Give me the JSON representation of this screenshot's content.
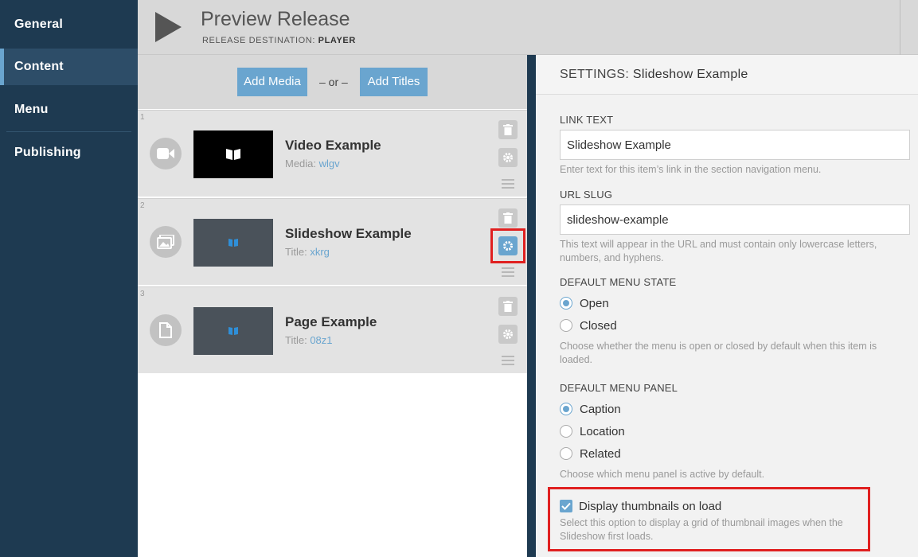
{
  "sidebar": {
    "items": [
      {
        "label": "General"
      },
      {
        "label": "Content"
      },
      {
        "label": "Menu"
      },
      {
        "label": "Publishing"
      }
    ]
  },
  "header": {
    "title": "Preview Release",
    "destination_label": "RELEASE DESTINATION:",
    "destination_value": "PLAYER"
  },
  "toolbar": {
    "add_media": "Add Media",
    "or": "– or –",
    "add_titles": "Add Titles"
  },
  "items": [
    {
      "number": "1",
      "title": "Video Example",
      "meta_label": "Media:",
      "meta_value": "wlgv",
      "type_icon": "video-camera-icon"
    },
    {
      "number": "2",
      "title": "Slideshow Example",
      "meta_label": "Title:",
      "meta_value": "xkrg",
      "type_icon": "images-icon"
    },
    {
      "number": "3",
      "title": "Page Example",
      "meta_label": "Title:",
      "meta_value": "08z1",
      "type_icon": "page-icon"
    }
  ],
  "settings": {
    "heading_prefix": "SETTINGS:",
    "heading_name": "Slideshow Example",
    "link_text_label": "LINK TEXT",
    "link_text_value": "Slideshow Example",
    "link_text_hint": "Enter text for this item’s link in the section navigation menu.",
    "url_slug_label": "URL SLUG",
    "url_slug_value": "slideshow-example",
    "url_slug_hint": "This text will appear in the URL and must contain only lowercase letters, numbers, and hyphens.",
    "menu_state_label": "DEFAULT MENU STATE",
    "menu_state_options": [
      "Open",
      "Closed"
    ],
    "menu_state_selected": "Open",
    "menu_state_hint": "Choose whether the menu is open or closed by default when this item is loaded.",
    "menu_panel_label": "DEFAULT MENU PANEL",
    "menu_panel_options": [
      "Caption",
      "Location",
      "Related"
    ],
    "menu_panel_selected": "Caption",
    "menu_panel_hint": "Choose which menu panel is active by default.",
    "thumbnails_label": "Display thumbnails on load",
    "thumbnails_checked": true,
    "thumbnails_hint": "Select this option to display a grid of thumbnail images when the Slideshow first loads."
  },
  "colors": {
    "sidebar": "#1e3a51",
    "accent": "#6aa5cf",
    "highlight": "#e02020"
  }
}
